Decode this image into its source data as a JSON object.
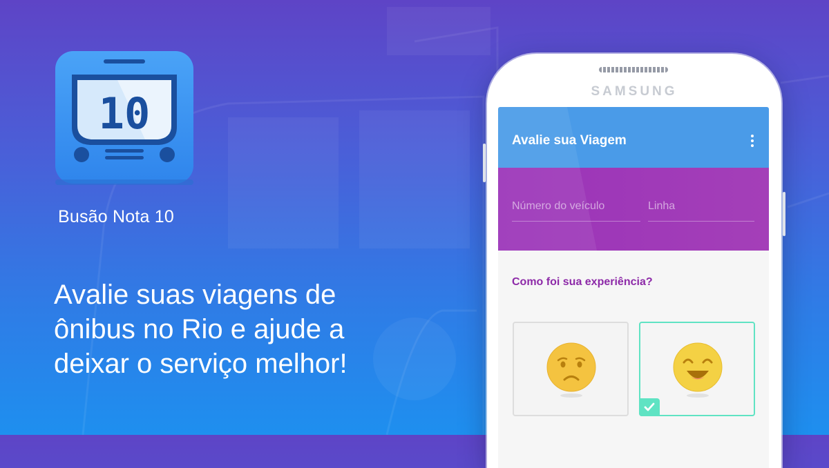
{
  "app": {
    "name": "Busão Nota 10",
    "icon_number": "10"
  },
  "tagline": "Avalie suas viagens de ônibus no Rio e ajude a deixar o serviço melhor!",
  "phone": {
    "brand": "SAMSUNG",
    "screen": {
      "appbar_title": "Avalie sua Viagem",
      "vehicle_placeholder": "Número do veículo",
      "line_placeholder": "Linha",
      "question": "Como foi sua experiência?",
      "options": [
        {
          "name": "sad-face",
          "selected": false
        },
        {
          "name": "happy-face",
          "selected": true
        }
      ]
    }
  },
  "colors": {
    "appbar": "#4a9be8",
    "panel": "#9a33b8",
    "question": "#8d2aa8",
    "selected": "#5fe3c3",
    "icon_blue": "#3d94f3"
  }
}
